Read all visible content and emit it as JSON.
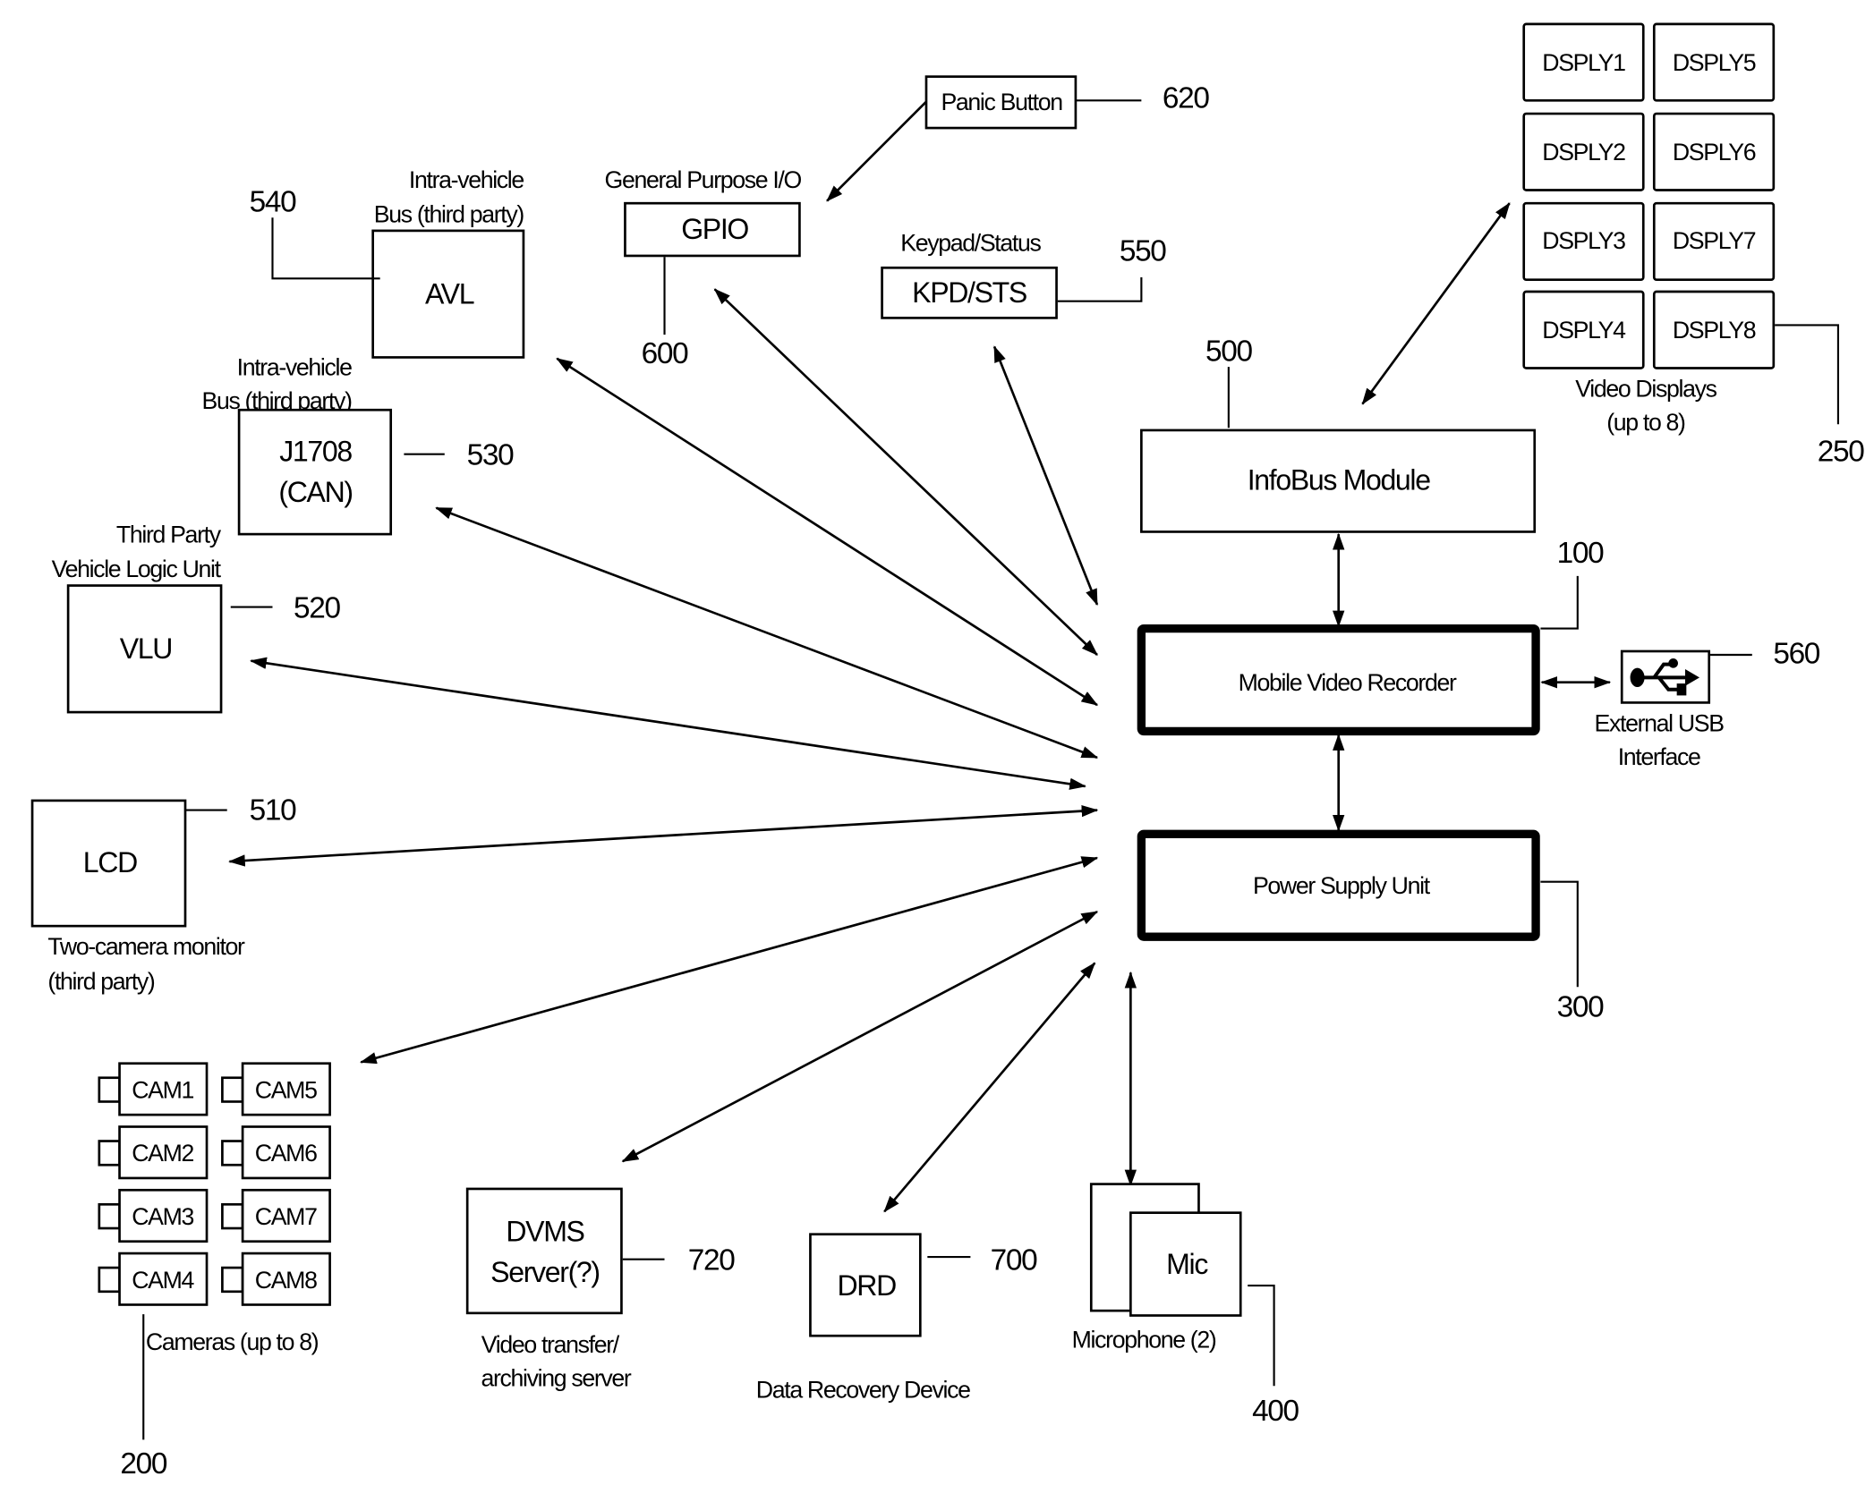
{
  "diagram": {
    "center": {
      "mvr": {
        "label": "Mobile Video Recorder",
        "ref": "100"
      },
      "psu": {
        "label": "Power Supply Unit",
        "ref": "300"
      },
      "infobus": {
        "label": "InfoBus Module",
        "ref": "500"
      }
    },
    "avl": {
      "label": "AVL",
      "caption": [
        "Intra-vehicle",
        "Bus (third party)"
      ],
      "ref": "540"
    },
    "j1708": {
      "label": [
        "J1708",
        "(CAN)"
      ],
      "caption": [
        "Intra-vehicle",
        "Bus (third party)"
      ],
      "ref": "530"
    },
    "vlu": {
      "label": "VLU",
      "caption": [
        "Third Party",
        "Vehicle Logic Unit"
      ],
      "ref": "520"
    },
    "lcd": {
      "label": "LCD",
      "caption": [
        "Two-camera monitor",
        "(third party)"
      ],
      "ref": "510"
    },
    "gpio": {
      "label": "GPIO",
      "caption": "General Purpose I/O",
      "ref": "600"
    },
    "panic": {
      "label": "Panic Button",
      "ref": "620"
    },
    "kpd": {
      "label": "KPD/STS",
      "caption": "Keypad/Status",
      "ref": "550"
    },
    "usb": {
      "caption": [
        "External USB",
        "Interface"
      ],
      "ref": "560",
      "icon": "usb-icon"
    },
    "displays": {
      "items": [
        "DSPLY1",
        "DSPLY2",
        "DSPLY3",
        "DSPLY4",
        "DSPLY5",
        "DSPLY6",
        "DSPLY7",
        "DSPLY8"
      ],
      "caption": [
        "Video Displays",
        "(up to 8)"
      ],
      "ref": "250"
    },
    "cameras": {
      "items": [
        "CAM1",
        "CAM2",
        "CAM3",
        "CAM4",
        "CAM5",
        "CAM6",
        "CAM7",
        "CAM8"
      ],
      "caption": "Cameras (up to 8)",
      "ref": "200"
    },
    "dvms": {
      "label": [
        "DVMS",
        "Server(?)"
      ],
      "caption": [
        "Video transfer/",
        "archiving server"
      ],
      "ref": "720"
    },
    "drd": {
      "label": "DRD",
      "caption": "Data Recovery Device",
      "ref": "700"
    },
    "mic": {
      "label": "Mic",
      "caption": "Microphone (2)",
      "ref": "400"
    }
  }
}
